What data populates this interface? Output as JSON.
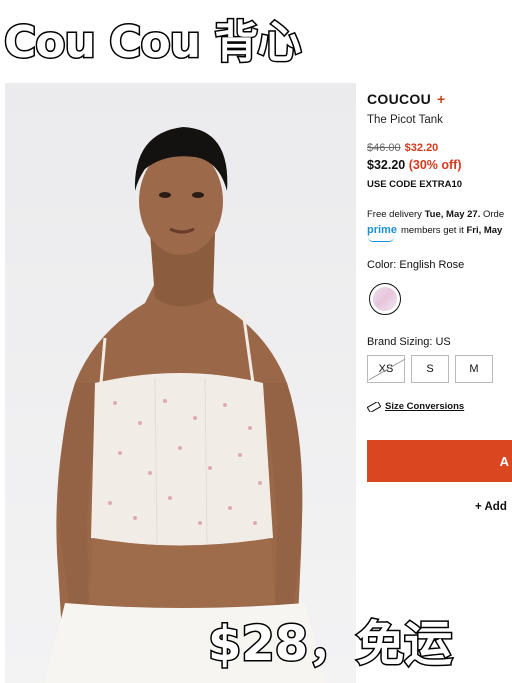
{
  "banner": {
    "title": "Cou Cou 背心",
    "price_text": "$28，免运"
  },
  "product": {
    "brand": "COUCOU",
    "brand_plus": "+",
    "name": "The Picot Tank",
    "original_price": "$46.00",
    "sale_price": "$32.20",
    "final_price": "$32.20",
    "discount": "(30% off)",
    "promo": "USE CODE EXTRA10",
    "delivery_prefix": "Free delivery ",
    "delivery_date": "Tue, May 27.",
    "delivery_suffix": " Orde",
    "prime_logo": "prime",
    "prime_text_prefix": "members get it ",
    "prime_date": "Fri, May",
    "color_label": "Color: English Rose",
    "size_label": "Brand Sizing: US",
    "sizes": [
      "XS",
      "S",
      "M"
    ],
    "size_conversions": "Size Conversions",
    "add_to_bag": "A",
    "wishlist": "+ Add"
  },
  "colors": {
    "accent": "#d9461f",
    "sale": "#d53a1e",
    "prime": "#1a8fd6"
  },
  "icons": {
    "swatch": "color-swatch",
    "ruler": "ruler-icon"
  }
}
